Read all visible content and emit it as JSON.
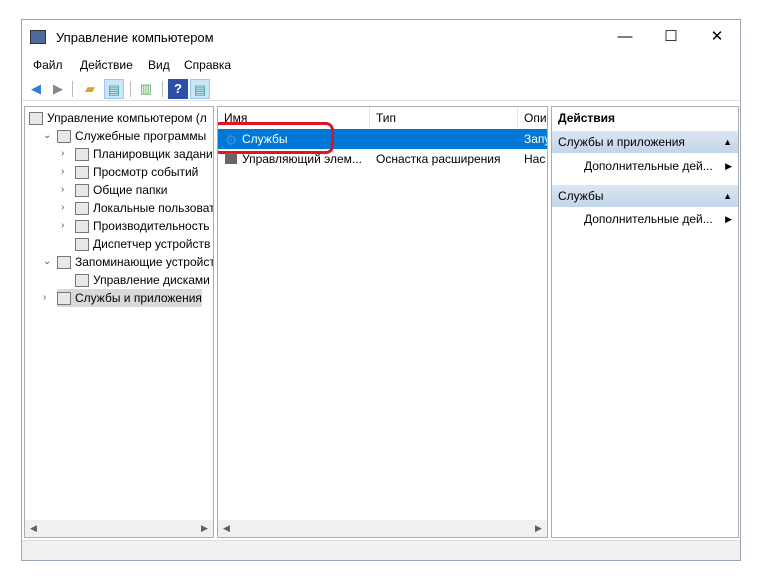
{
  "window": {
    "title": "Управление компьютером",
    "minimize": "—",
    "maximize": "☐",
    "close": "✕"
  },
  "menu": [
    "Файл",
    "Действие",
    "Вид",
    "Справка"
  ],
  "tree": [
    {
      "label": "Управление компьютером (л",
      "level": 0,
      "expander": ""
    },
    {
      "label": "Служебные программы",
      "level": 1,
      "expander": "⌄"
    },
    {
      "label": "Планировщик задани",
      "level": 2,
      "expander": "›"
    },
    {
      "label": "Просмотр событий",
      "level": 2,
      "expander": "›"
    },
    {
      "label": "Общие папки",
      "level": 2,
      "expander": "›"
    },
    {
      "label": "Локальные пользовате",
      "level": 2,
      "expander": "›"
    },
    {
      "label": "Производительность",
      "level": 2,
      "expander": "›"
    },
    {
      "label": "Диспетчер устройств",
      "level": 2,
      "expander": ""
    },
    {
      "label": "Запоминающие устройст",
      "level": 1,
      "expander": "⌄"
    },
    {
      "label": "Управление дисками",
      "level": 2,
      "expander": ""
    },
    {
      "label": "Службы и приложения",
      "level": 1,
      "expander": "›",
      "selected": true
    }
  ],
  "list": {
    "columns": [
      "Имя",
      "Тип",
      "Опи"
    ],
    "rows": [
      [
        "Службы",
        "",
        "Запу"
      ],
      [
        "Управляющий элем...",
        "Оснастка расширения",
        "Нас"
      ]
    ]
  },
  "actions": {
    "title": "Действия",
    "sections": [
      {
        "header": "Службы и приложения",
        "item": "Дополнительные дей..."
      },
      {
        "header": "Службы",
        "item": "Дополнительные дей..."
      }
    ]
  },
  "highlight_color": "#e0141e",
  "selection_color": "#0078d7"
}
